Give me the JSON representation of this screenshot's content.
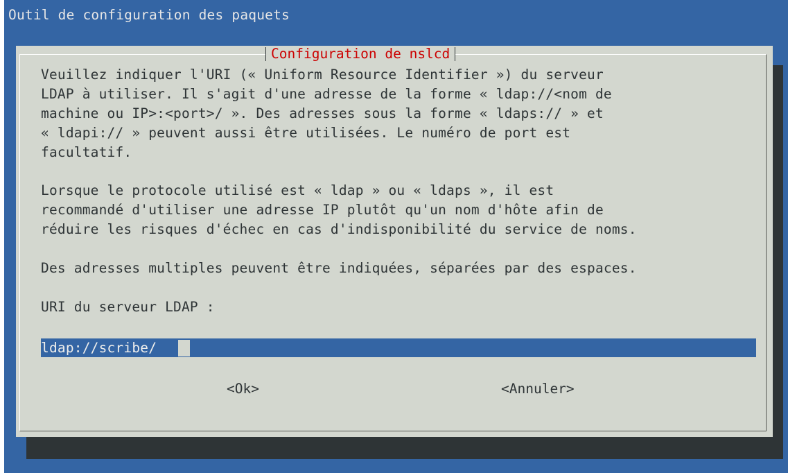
{
  "backtitle": "Outil de configuration des paquets",
  "dialog": {
    "title": "Configuration de nslcd",
    "lines": [
      "Veuillez indiquer l'URI (« Uniform Resource Identifier ») du serveur",
      "LDAP à utiliser. Il s'agit d'une adresse de la forme « ldap://<nom de",
      "machine ou IP>:<port>/ ». Des adresses sous la forme « ldaps:// » et",
      "« ldapi:// » peuvent aussi être utilisées. Le numéro de port est",
      "facultatif.",
      "Lorsque le protocole utilisé est « ldap » ou « ldaps », il est",
      "recommandé d'utiliser une adresse IP plutôt qu'un nom d'hôte afin de",
      "réduire les risques d'échec en cas d'indisponibilité du service de noms.",
      "Des adresses multiples peuvent être indiquées, séparées par des espaces.",
      "URI du serveur LDAP :"
    ],
    "input_value": "ldap://scribe/",
    "ok_label": "<Ok>",
    "cancel_label": "<Annuler>"
  },
  "colors": {
    "background": "#3465a4",
    "dialog": "#d3d7cf",
    "shadow": "#2e3436",
    "title": "#cc0000",
    "input": "#3465a4"
  }
}
